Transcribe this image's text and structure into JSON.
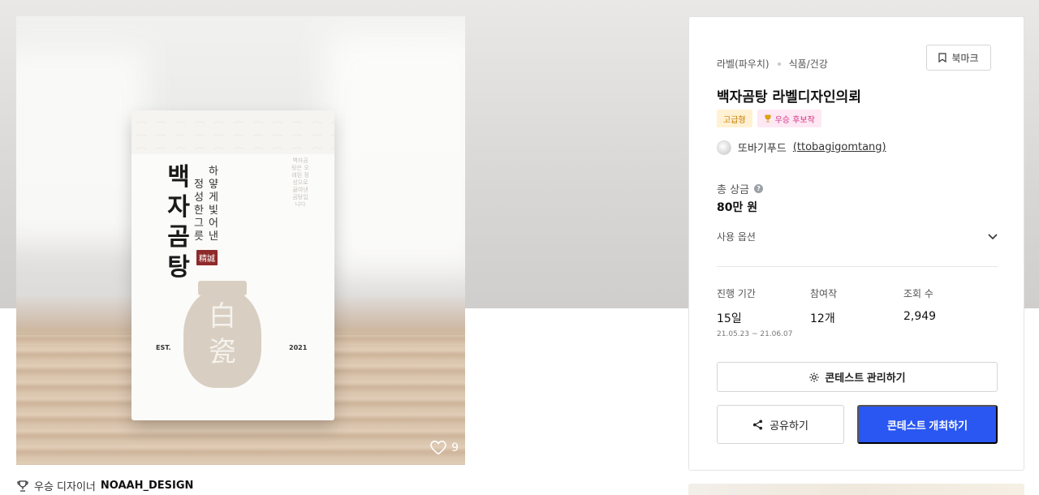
{
  "product_image": {
    "pouch": {
      "title": "백자곰탕",
      "subtitle_line1": "하얗게 빛어낸",
      "subtitle_line2": "정성 한 그릇",
      "seal": "精誠",
      "jar_text": "白瓷",
      "est": "EST.",
      "year": "2021",
      "side_text": "백자곰탕은 오래된 정성으로 끓여낸 곰탕입니다"
    },
    "likes": "9"
  },
  "winner": {
    "label": "우승 디자이너",
    "name": "NOAAH_DESIGN"
  },
  "card": {
    "breadcrumb": [
      "라벨(파우치)",
      "식품/건강"
    ],
    "bookmark_label": "북마크",
    "title": "백자곰탕 라벨디자인의뢰",
    "badges": {
      "premium": "고급형",
      "runner_up": "우승 후보작"
    },
    "owner": {
      "name": "또바기푸드",
      "handle": "(ttobagigomtang)"
    },
    "prize": {
      "label": "총 상금",
      "value": "80만 원"
    },
    "usage_option_label": "사용 옵션",
    "stats": {
      "duration": {
        "label": "진행 기간",
        "value": "15일",
        "range": "21.05.23 ~ 21.06.07"
      },
      "entries": {
        "label": "참여작",
        "value": "12개"
      },
      "views": {
        "label": "조회 수",
        "value": "2,949"
      }
    },
    "buttons": {
      "manage": "콘테스트 관리하기",
      "share": "공유하기",
      "host": "콘테스트 개최하기"
    }
  },
  "colors": {
    "primary": "#2a56f2",
    "premium_badge_bg": "#fff1d2",
    "premium_badge_text": "#c77b00",
    "runner_badge_bg": "#fde8f3",
    "runner_badge_text": "#d63384"
  }
}
